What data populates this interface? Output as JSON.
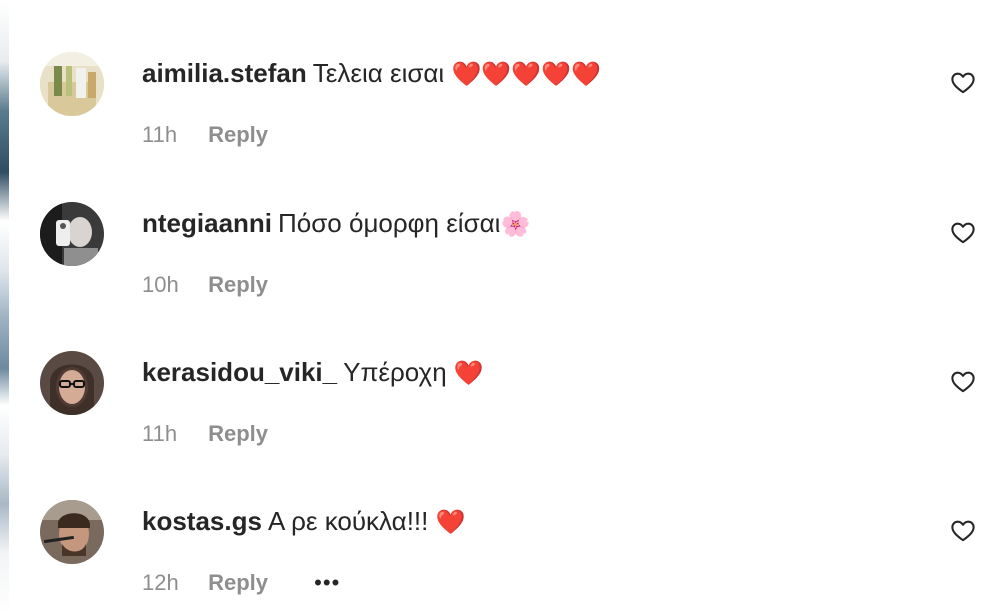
{
  "comments": [
    {
      "username": "aimilia.stefan",
      "text": "Τελεια εισαι",
      "emoji": "❤️❤️❤️❤️❤️",
      "time": "11h",
      "reply_label": "Reply",
      "avatar_icon": "avatar-photo-icon",
      "like_icon": "heart-outline-icon"
    },
    {
      "username": "ntegiaanni",
      "text": "Πόσο όμορφη είσαι",
      "emoji": "🌸",
      "time": "10h",
      "reply_label": "Reply",
      "avatar_icon": "avatar-photo-icon",
      "like_icon": "heart-outline-icon"
    },
    {
      "username": "kerasidou_viki_",
      "text": "Υπέροχη",
      "emoji": "❤️",
      "time": "11h",
      "reply_label": "Reply",
      "avatar_icon": "avatar-photo-icon",
      "like_icon": "heart-outline-icon"
    },
    {
      "username": "kostas.gs",
      "text": "Α ρε κούκλα!!!",
      "emoji": "❤️",
      "time": "12h",
      "reply_label": "Reply",
      "more_label": "•••",
      "avatar_icon": "avatar-photo-icon",
      "like_icon": "heart-outline-icon"
    }
  ],
  "colors": {
    "username": "#262626",
    "meta": "#8e8e8e",
    "heart_emoji": "#ed1c2f"
  }
}
